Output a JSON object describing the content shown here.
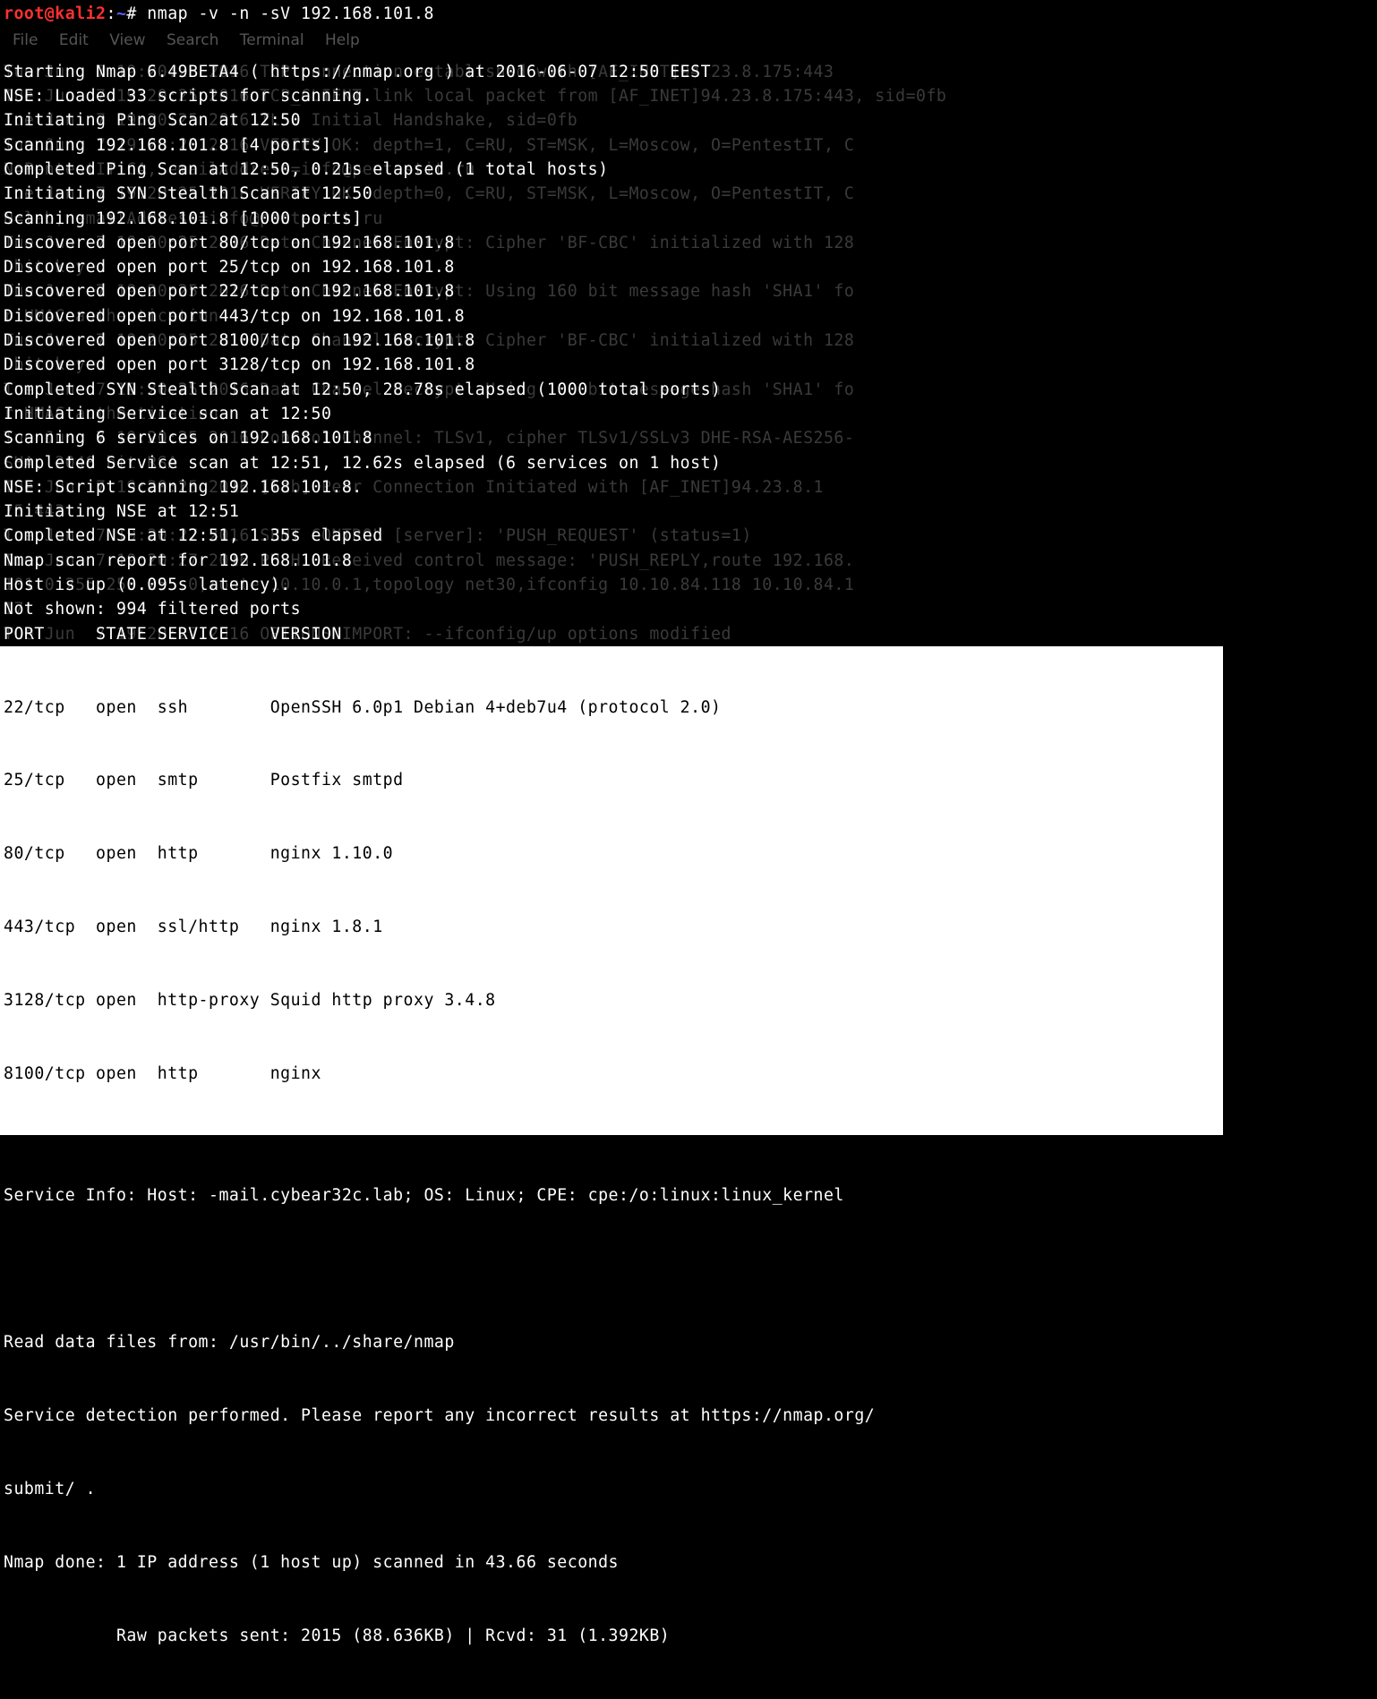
{
  "prompt": {
    "user_host": "root@kali2",
    "tilde": "~",
    "hash": "#",
    "command": " nmap -v -n -sV 192.168.101.8"
  },
  "menubar": [
    "File",
    "Edit",
    "View",
    "Search",
    "Terminal",
    "Help"
  ],
  "ghost_lines": {
    "0": "Tue Jun  7 19:20:25 2016 TCP connection established with [AF_INET]94.23.8.175:443",
    "1": "Tue Jun  7 19:20:25 2016 TCP_CLIENT link local packet from [AF_INET]94.23.8.175:443, sid=0fb",
    "3": "Tue Jun  7 19:20:25 2016 TLS: Initial Handshake, sid=0fb",
    "4": "Tue Jun  7 19:20:25 2016 VERIFY OK: depth=1, C=RU, ST=MSK, L=Moscow, O=PentestIT, C",
    "5": "N=PentestIT CA, emailAddress=info@pentestit.ru",
    "6": "Tue Jun  7 19:20:25 2016 VERIFY OK: depth=0, C=RU, ST=MSK, L=Moscow, O=PentestIT, C",
    "7": "N=lab, emailAddress=info@pentestit.ru",
    "8": "Tue Jun  7 19:20:25 2016 Data Channel Encrypt: Cipher 'BF-CBC' initialized with 128",
    "9": " bit key",
    "10": "Tue Jun  7 19:20:25 2016 Data Channel Encrypt: Using 160 bit message hash 'SHA1' fo",
    "11": "r HMAC authentication",
    "12": "Tue Jun  7 19:20:25 2016 Data Channel Decrypt: Cipher 'BF-CBC' initialized with 128",
    "13": " bit key",
    "14": "Tue Jun  7 19:20:25 2016 Data Channel Decrypt: Using 160 bit message hash 'SHA1' fo",
    "15": "r HMAC authentication",
    "16": "Tue Jun  7 19:20:25 2016 Control Channel: TLSv1, cipher TLSv1/SSLv3 DHE-RSA-AES256-",
    "17": "SHA, 2048 bit RSA",
    "18": "Tue Jun  7 19:20:25 2016 [lab] Peer Connection Initiated with [AF_INET]94.23.8.1",
    "19": "75:443",
    "20": "Tue Jun  7 19:20:27 2016 SENT CONTROL [server]: 'PUSH_REQUEST' (status=1)",
    "21": "Tue Jun  7 19:20:27 2016 PUSH: Received control message: 'PUSH_REPLY,route 192.168.",
    "22": "101.0 255.255.255.0,route 10.10.0.1,topology net30,ifconfig 10.10.84.118 10.10.84.1",
    "23": "17'",
    "24": "Tue Jun  7 19:20:27 2016 OPTIONS IMPORT: --ifconfig/up options modified"
  },
  "fg_lines": [
    "Starting Nmap 6.49BETA4 ( https://nmap.org ) at 2016-06-07 12:50 EEST",
    "NSE: Loaded 33 scripts for scanning.",
    "Initiating Ping Scan at 12:50",
    "Scanning 192.168.101.8 [4 ports]",
    "Completed Ping Scan at 12:50, 0.21s elapsed (1 total hosts)",
    "Initiating SYN Stealth Scan at 12:50",
    "Scanning 192.168.101.8 [1000 ports]",
    "Discovered open port 80/tcp on 192.168.101.8",
    "Discovered open port 25/tcp on 192.168.101.8",
    "Discovered open port 22/tcp on 192.168.101.8",
    "Discovered open port 443/tcp on 192.168.101.8",
    "Discovered open port 8100/tcp on 192.168.101.8",
    "Discovered open port 3128/tcp on 192.168.101.8",
    "Completed SYN Stealth Scan at 12:50, 28.78s elapsed (1000 total ports)",
    "Initiating Service scan at 12:50",
    "Scanning 6 services on 192.168.101.8",
    "Completed Service scan at 12:51, 12.62s elapsed (6 services on 1 host)",
    "NSE: Script scanning 192.168.101.8.",
    "Initiating NSE at 12:51",
    "Completed NSE at 12:51, 1.35s elapsed",
    "Nmap scan report for 192.168.101.8",
    "Host is up (0.095s latency).",
    "Not shown: 994 filtered ports"
  ],
  "table_header": "PORT     STATE SERVICE    VERSION",
  "ports": [
    "22/tcp   open  ssh        OpenSSH 6.0p1 Debian 4+deb7u4 (protocol 2.0)",
    "25/tcp   open  smtp       Postfix smtpd",
    "80/tcp   open  http       nginx 1.10.0",
    "443/tcp  open  ssl/http   nginx 1.8.1",
    "3128/tcp open  http-proxy Squid http proxy 3.4.8",
    "8100/tcp open  http       nginx"
  ],
  "footer": [
    "Service Info: Host: -mail.cybear32c.lab; OS: Linux; CPE: cpe:/o:linux:linux_kernel",
    "",
    "Read data files from: /usr/bin/../share/nmap",
    "Service detection performed. Please report any incorrect results at https://nmap.org/",
    "submit/ .",
    "Nmap done: 1 IP address (1 host up) scanned in 43.66 seconds",
    "           Raw packets sent: 2015 (88.636KB) | Rcvd: 31 (1.392KB)"
  ]
}
